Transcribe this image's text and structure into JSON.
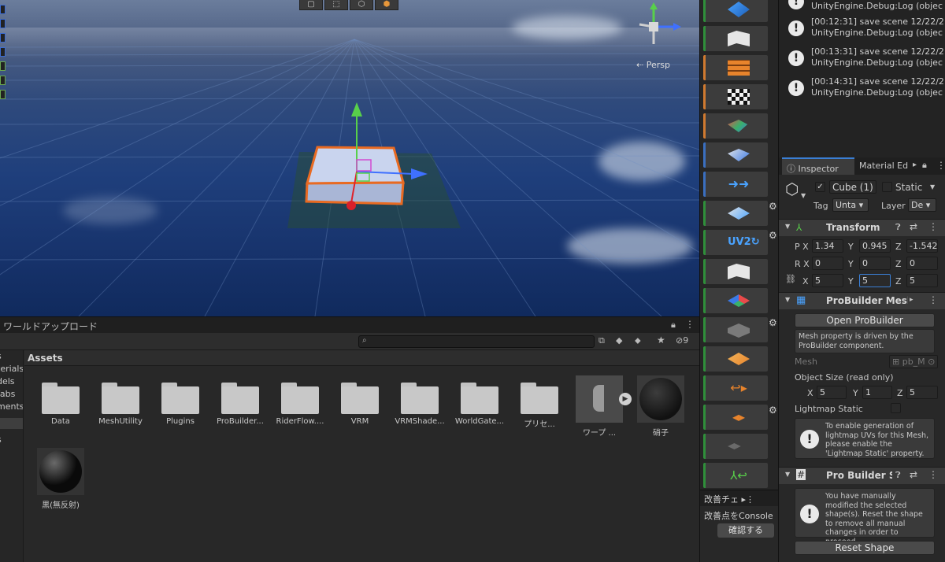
{
  "scene": {
    "view_mode": "Persp",
    "toolbar_icons": [
      "box-icon",
      "rect-tool-icon",
      "cube-icon",
      "orange-cube-icon"
    ]
  },
  "project": {
    "window_title": "ワールドアップロード",
    "hidden_count": "9",
    "breadcrumb": "Assets",
    "tree_items": [
      "s",
      "terials",
      "dels",
      "fabs",
      "ments",
      "",
      "s"
    ],
    "assets": [
      {
        "label": "Data",
        "kind": "folder"
      },
      {
        "label": "MeshUtility",
        "kind": "folder"
      },
      {
        "label": "Plugins",
        "kind": "folder"
      },
      {
        "label": "ProBuilder...",
        "kind": "folder"
      },
      {
        "label": "RiderFlow....",
        "kind": "folder"
      },
      {
        "label": "VRM",
        "kind": "folder"
      },
      {
        "label": "VRMShade...",
        "kind": "folder"
      },
      {
        "label": "WorldGate...",
        "kind": "folder"
      },
      {
        "label": "プリセ...",
        "kind": "folder"
      },
      {
        "label": "ワープ ...",
        "kind": "prefab"
      },
      {
        "label": "硝子",
        "kind": "material"
      },
      {
        "label": "黒(無反射)",
        "kind": "material"
      }
    ]
  },
  "probuilder_tools": [
    {
      "icon": "new-shape-icon",
      "accent": "green"
    },
    {
      "icon": "poly-shape-icon",
      "accent": "green"
    },
    {
      "icon": "material-editor-icon",
      "accent": "orange"
    },
    {
      "icon": "uv-editor-icon",
      "accent": "orange"
    },
    {
      "icon": "vertex-colors-icon",
      "accent": "orange"
    },
    {
      "icon": "smoothing-icon",
      "accent": "blue"
    },
    {
      "icon": "select-mode-icon",
      "accent": "blue"
    },
    {
      "icon": "subdivide-icon",
      "accent": "green",
      "gear": true
    },
    {
      "icon": "uv2-icon",
      "label": "UV2",
      "accent": "green",
      "gear": true
    },
    {
      "icon": "flip-normals-icon",
      "accent": "green"
    },
    {
      "icon": "center-pivot-icon",
      "accent": "green"
    },
    {
      "icon": "conform-normals-icon",
      "accent": "green",
      "gear": true
    },
    {
      "icon": "triangulate-icon",
      "accent": "green"
    },
    {
      "icon": "mirror-objects-icon",
      "accent": "green"
    },
    {
      "icon": "merge-objects-icon",
      "accent": "green",
      "gear": true
    },
    {
      "icon": "export-icon",
      "accent": "green"
    },
    {
      "icon": "reset-pivot-icon",
      "accent": "green"
    }
  ],
  "kaizen": {
    "tab_label": "改善チェ",
    "line": "改善点をConsole",
    "button": "確認する"
  },
  "console": {
    "logs": [
      {
        "line1": "",
        "line2": "UnityEngine.Debug:Log (objec"
      },
      {
        "line1": "[00:12:31] save scene 12/22/2",
        "line2": "UnityEngine.Debug:Log (objec"
      },
      {
        "line1": "[00:13:31] save scene 12/22/2",
        "line2": "UnityEngine.Debug:Log (objec"
      },
      {
        "line1": "[00:14:31] save scene 12/22/2",
        "line2": "UnityEngine.Debug:Log (objec"
      }
    ]
  },
  "inspector": {
    "tabs": [
      "Inspector",
      "Material Ed"
    ],
    "object_name": "Cube (1)",
    "static_label": "Static",
    "tag_label": "Tag",
    "tag_value": "Unta",
    "layer_label": "Layer",
    "layer_value": "De",
    "transform": {
      "title": "Transform",
      "position": {
        "label": "P",
        "x": "1.34",
        "y": "0.945",
        "z": "-1.542"
      },
      "rotation": {
        "label": "R",
        "x": "0",
        "y": "0",
        "z": "0"
      },
      "scale": {
        "x": "5",
        "y": "5",
        "z": "5"
      }
    },
    "mesh_filter": {
      "title": "ProBuilder MeshF",
      "open_button": "Open ProBuilder",
      "note": "Mesh property is driven by the ProBuilder component.",
      "mesh_label": "Mesh",
      "mesh_value": "pb_M",
      "object_size_label": "Object Size (read only)",
      "size": {
        "x": "5",
        "y": "1",
        "z": "5"
      },
      "lightmap_label": "Lightmap Static",
      "lightmap_help": "To enable generation of lightmap UVs for this Mesh, please enable the 'Lightmap Static' property."
    },
    "pro_builder_shape": {
      "title": "Pro Builder Sh",
      "help": "You have manually modified the selected shape(s). Reset the shape to remove all manual changes in order to proceed.",
      "reset_button": "Reset Shape"
    }
  }
}
